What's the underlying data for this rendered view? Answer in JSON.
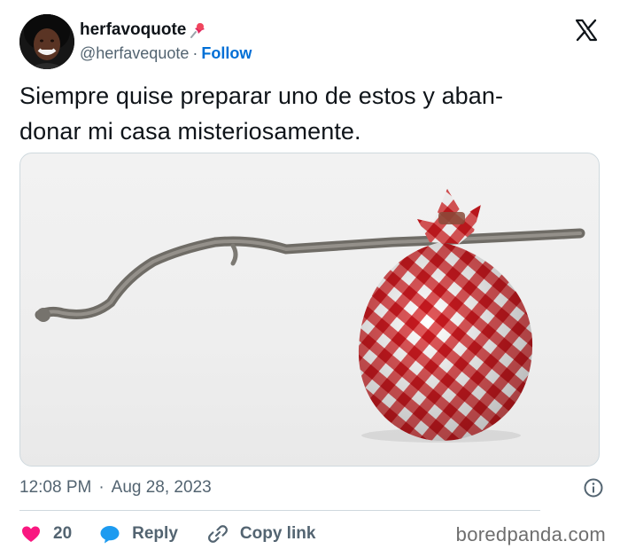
{
  "user": {
    "display_name": "herfavoquote",
    "pin_icon": "pushpin-icon",
    "handle": "@herfavequote",
    "separator": "·",
    "follow_label": "Follow"
  },
  "tweet": {
    "text_line1": "Siempre quise preparar uno de estos y aban-",
    "text_line2": "donar mi casa misteriosamente."
  },
  "meta": {
    "time": "12:08 PM",
    "separator": "·",
    "date": "Aug 28, 2023"
  },
  "actions": {
    "like_count": "20",
    "reply_label": "Reply",
    "copy_link_label": "Copy link"
  },
  "watermark": "boredpanda.com",
  "colors": {
    "like": "#f91880",
    "reply": "#1d9bf0",
    "follow": "#006fd6",
    "muted": "#536471",
    "text": "#0f1419",
    "gingham_red": "#d8282b"
  }
}
